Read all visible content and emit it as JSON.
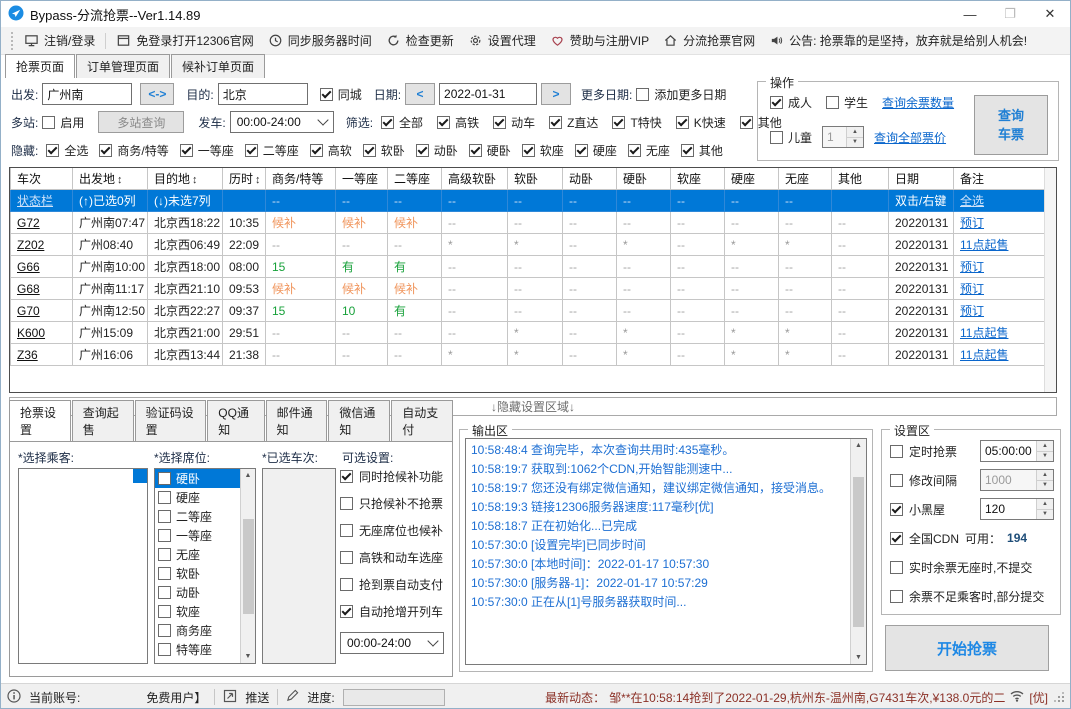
{
  "window": {
    "title": "Bypass-分流抢票--Ver1.14.89",
    "minimize": "—",
    "maximize": "❐",
    "close": "✕"
  },
  "toolbar": {
    "items": [
      {
        "label": "注销/登录",
        "icon": "monitor-icon",
        "sep_after": true
      },
      {
        "label": "免登录打开12306官网",
        "icon": "window-icon"
      },
      {
        "label": "同步服务器时间",
        "icon": "clock-icon"
      },
      {
        "label": "检查更新",
        "icon": "refresh-icon"
      },
      {
        "label": "设置代理",
        "icon": "gear-icon"
      },
      {
        "label": "赞助与注册VIP",
        "icon": "heart-icon"
      },
      {
        "label": "分流抢票官网",
        "icon": "home-icon"
      },
      {
        "label": "公告:  抢票靠的是坚持，放弃就是给别人机会!",
        "icon": "speaker-icon"
      }
    ]
  },
  "page_tabs": {
    "items": [
      {
        "label": "抢票页面"
      },
      {
        "label": "订单管理页面"
      },
      {
        "label": "候补订单页面"
      }
    ],
    "active": 0
  },
  "search": {
    "depart_label": "出发:",
    "depart_value": "广州南",
    "swap_label": "<->",
    "dest_label": "目的:",
    "dest_value": "北京",
    "same_city": {
      "label": "同城",
      "checked": true
    },
    "date_label": "日期:",
    "prev_label": "<",
    "date_value": "2022-01-31",
    "next_label": ">",
    "more_label": "更多日期:",
    "add_more": {
      "label": "添加更多日期",
      "checked": false
    }
  },
  "multi": {
    "label": "多站:",
    "enable": {
      "label": "启用",
      "checked": false
    },
    "query_btn": "多站查询",
    "depart_time_label": "发车:",
    "depart_time": "00:00-24:00",
    "filter_label": "筛选:",
    "filters": [
      {
        "label": "全部",
        "checked": true
      },
      {
        "label": "高铁",
        "checked": true
      },
      {
        "label": "动车",
        "checked": true
      },
      {
        "label": "Z直达",
        "checked": true
      },
      {
        "label": "T特快",
        "checked": true
      },
      {
        "label": "K快速",
        "checked": true
      },
      {
        "label": "其他",
        "checked": true
      }
    ]
  },
  "hide": {
    "label": "隐藏:",
    "items": [
      {
        "label": "全选",
        "checked": true
      },
      {
        "label": "商务/特等",
        "checked": true
      },
      {
        "label": "一等座",
        "checked": true
      },
      {
        "label": "二等座",
        "checked": true
      },
      {
        "label": "高软",
        "checked": true
      },
      {
        "label": "软卧",
        "checked": true
      },
      {
        "label": "动卧",
        "checked": true
      },
      {
        "label": "硬卧",
        "checked": true
      },
      {
        "label": "软座",
        "checked": true
      },
      {
        "label": "硬座",
        "checked": true
      },
      {
        "label": "无座",
        "checked": true
      },
      {
        "label": "其他",
        "checked": true
      }
    ]
  },
  "operation": {
    "title": "操作",
    "adult": {
      "label": "成人",
      "checked": true
    },
    "student": {
      "label": "学生",
      "checked": false
    },
    "child": {
      "label": "儿童",
      "checked": false
    },
    "child_count": "1",
    "link_seats": "查询余票数量",
    "link_price": "查询全部票价",
    "query_button_line1": "查询",
    "query_button_line2": "车票"
  },
  "table": {
    "columns": [
      {
        "label": "车次"
      },
      {
        "label": "出发地",
        "sort": "↕"
      },
      {
        "label": "目的地",
        "sort": "↕"
      },
      {
        "label": "历时",
        "sort": "↕"
      },
      {
        "label": "商务/特等"
      },
      {
        "label": "一等座"
      },
      {
        "label": "二等座"
      },
      {
        "label": "高级软卧"
      },
      {
        "label": "软卧"
      },
      {
        "label": "动卧"
      },
      {
        "label": "硬卧"
      },
      {
        "label": "软座"
      },
      {
        "label": "硬座"
      },
      {
        "label": "无座"
      },
      {
        "label": "其他"
      },
      {
        "label": "日期"
      },
      {
        "label": "备注"
      }
    ],
    "rows": [
      {
        "selected": true,
        "cells": [
          {
            "t": "状态栏",
            "s": "wlink"
          },
          {
            "t": "(↑)已选0列"
          },
          {
            "t": "(↓)未选7列"
          },
          {
            "t": ""
          },
          {
            "t": "--",
            "s": "dash"
          },
          {
            "t": "--",
            "s": "dash"
          },
          {
            "t": "--",
            "s": "dash"
          },
          {
            "t": "--",
            "s": "dash"
          },
          {
            "t": "--",
            "s": "dash"
          },
          {
            "t": "--",
            "s": "dash"
          },
          {
            "t": "--",
            "s": "dash"
          },
          {
            "t": "--",
            "s": "dash"
          },
          {
            "t": "--",
            "s": "dash"
          },
          {
            "t": "--",
            "s": "dash"
          },
          {
            "t": ""
          },
          {
            "t": "双击/右键"
          },
          {
            "t": "全选",
            "s": "wlink"
          }
        ]
      },
      {
        "cells": [
          {
            "t": "G72",
            "s": "train"
          },
          {
            "t": "广州南07:47"
          },
          {
            "t": "北京西18:22"
          },
          {
            "t": "10:35"
          },
          {
            "t": "候补",
            "s": "orange"
          },
          {
            "t": "候补",
            "s": "orange"
          },
          {
            "t": "候补",
            "s": "orange"
          },
          {
            "t": "--",
            "s": "dash"
          },
          {
            "t": "--",
            "s": "dash"
          },
          {
            "t": "--",
            "s": "dash"
          },
          {
            "t": "--",
            "s": "dash"
          },
          {
            "t": "--",
            "s": "dash"
          },
          {
            "t": "--",
            "s": "dash"
          },
          {
            "t": "--",
            "s": "dash"
          },
          {
            "t": "--",
            "s": "dash"
          },
          {
            "t": "20220131"
          },
          {
            "t": "预订",
            "s": "link"
          }
        ]
      },
      {
        "cells": [
          {
            "t": "Z202",
            "s": "train"
          },
          {
            "t": "广州08:40"
          },
          {
            "t": "北京西06:49"
          },
          {
            "t": "22:09"
          },
          {
            "t": "--",
            "s": "dash"
          },
          {
            "t": "--",
            "s": "dash"
          },
          {
            "t": "--",
            "s": "dash"
          },
          {
            "t": "*",
            "s": "star"
          },
          {
            "t": "*",
            "s": "star"
          },
          {
            "t": "--",
            "s": "dash"
          },
          {
            "t": "*",
            "s": "star"
          },
          {
            "t": "--",
            "s": "dash"
          },
          {
            "t": "*",
            "s": "star"
          },
          {
            "t": "*",
            "s": "star"
          },
          {
            "t": "--",
            "s": "dash"
          },
          {
            "t": "20220131"
          },
          {
            "t": "11点起售",
            "s": "link"
          }
        ]
      },
      {
        "cells": [
          {
            "t": "G66",
            "s": "train"
          },
          {
            "t": "广州南10:00"
          },
          {
            "t": "北京西18:00"
          },
          {
            "t": "08:00"
          },
          {
            "t": "15",
            "s": "green"
          },
          {
            "t": "有",
            "s": "green"
          },
          {
            "t": "有",
            "s": "green"
          },
          {
            "t": "--",
            "s": "dash"
          },
          {
            "t": "--",
            "s": "dash"
          },
          {
            "t": "--",
            "s": "dash"
          },
          {
            "t": "--",
            "s": "dash"
          },
          {
            "t": "--",
            "s": "dash"
          },
          {
            "t": "--",
            "s": "dash"
          },
          {
            "t": "--",
            "s": "dash"
          },
          {
            "t": "--",
            "s": "dash"
          },
          {
            "t": "20220131"
          },
          {
            "t": "预订",
            "s": "link"
          }
        ]
      },
      {
        "cells": [
          {
            "t": "G68",
            "s": "train"
          },
          {
            "t": "广州南11:17"
          },
          {
            "t": "北京西21:10"
          },
          {
            "t": "09:53"
          },
          {
            "t": "候补",
            "s": "orange"
          },
          {
            "t": "候补",
            "s": "orange"
          },
          {
            "t": "候补",
            "s": "orange"
          },
          {
            "t": "--",
            "s": "dash"
          },
          {
            "t": "--",
            "s": "dash"
          },
          {
            "t": "--",
            "s": "dash"
          },
          {
            "t": "--",
            "s": "dash"
          },
          {
            "t": "--",
            "s": "dash"
          },
          {
            "t": "--",
            "s": "dash"
          },
          {
            "t": "--",
            "s": "dash"
          },
          {
            "t": "--",
            "s": "dash"
          },
          {
            "t": "20220131"
          },
          {
            "t": "预订",
            "s": "link"
          }
        ]
      },
      {
        "cells": [
          {
            "t": "G70",
            "s": "train"
          },
          {
            "t": "广州南12:50"
          },
          {
            "t": "北京西22:27"
          },
          {
            "t": "09:37"
          },
          {
            "t": "15",
            "s": "green"
          },
          {
            "t": "10",
            "s": "green"
          },
          {
            "t": "有",
            "s": "green"
          },
          {
            "t": "--",
            "s": "dash"
          },
          {
            "t": "--",
            "s": "dash"
          },
          {
            "t": "--",
            "s": "dash"
          },
          {
            "t": "--",
            "s": "dash"
          },
          {
            "t": "--",
            "s": "dash"
          },
          {
            "t": "--",
            "s": "dash"
          },
          {
            "t": "--",
            "s": "dash"
          },
          {
            "t": "--",
            "s": "dash"
          },
          {
            "t": "20220131"
          },
          {
            "t": "预订",
            "s": "link"
          }
        ]
      },
      {
        "cells": [
          {
            "t": "K600",
            "s": "train"
          },
          {
            "t": "广州15:09"
          },
          {
            "t": "北京西21:00"
          },
          {
            "t": "29:51"
          },
          {
            "t": "--",
            "s": "dash"
          },
          {
            "t": "--",
            "s": "dash"
          },
          {
            "t": "--",
            "s": "dash"
          },
          {
            "t": "--",
            "s": "dash"
          },
          {
            "t": "*",
            "s": "star"
          },
          {
            "t": "--",
            "s": "dash"
          },
          {
            "t": "*",
            "s": "star"
          },
          {
            "t": "--",
            "s": "dash"
          },
          {
            "t": "*",
            "s": "star"
          },
          {
            "t": "*",
            "s": "star"
          },
          {
            "t": "--",
            "s": "dash"
          },
          {
            "t": "20220131"
          },
          {
            "t": "11点起售",
            "s": "link"
          }
        ]
      },
      {
        "cells": [
          {
            "t": "Z36",
            "s": "train"
          },
          {
            "t": "广州16:06"
          },
          {
            "t": "北京西13:44"
          },
          {
            "t": "21:38"
          },
          {
            "t": "--",
            "s": "dash"
          },
          {
            "t": "--",
            "s": "dash"
          },
          {
            "t": "--",
            "s": "dash"
          },
          {
            "t": "*",
            "s": "star"
          },
          {
            "t": "*",
            "s": "star"
          },
          {
            "t": "--",
            "s": "dash"
          },
          {
            "t": "*",
            "s": "star"
          },
          {
            "t": "--",
            "s": "dash"
          },
          {
            "t": "*",
            "s": "star"
          },
          {
            "t": "*",
            "s": "star"
          },
          {
            "t": "--",
            "s": "dash"
          },
          {
            "t": "20220131"
          },
          {
            "t": "11点起售",
            "s": "link"
          }
        ]
      }
    ]
  },
  "divider_label": "↓隐藏设置区域↓",
  "settings_tabs": {
    "items": [
      {
        "label": "抢票设置"
      },
      {
        "label": "查询起售"
      },
      {
        "label": "验证码设置"
      },
      {
        "label": "QQ通知"
      },
      {
        "label": "邮件通知"
      },
      {
        "label": "微信通知"
      },
      {
        "label": "自动支付"
      }
    ],
    "active": 0
  },
  "grab": {
    "passengers_label": "*选择乘客:",
    "seats_label": "*选择席位:",
    "trains_label": "*已选车次:",
    "options_label": "可选设置:",
    "seats": [
      {
        "label": "硬卧",
        "checked": false,
        "selected": true
      },
      {
        "label": "硬座",
        "checked": false
      },
      {
        "label": "二等座",
        "checked": false
      },
      {
        "label": "一等座",
        "checked": false
      },
      {
        "label": "无座",
        "checked": false
      },
      {
        "label": "软卧",
        "checked": false
      },
      {
        "label": "动卧",
        "checked": false
      },
      {
        "label": "软座",
        "checked": false
      },
      {
        "label": "商务座",
        "checked": false
      },
      {
        "label": "特等座",
        "checked": false
      }
    ],
    "options": [
      {
        "label": "同时抢候补功能",
        "checked": true
      },
      {
        "label": "只抢候补不抢票",
        "checked": false
      },
      {
        "label": "无座席位也候补",
        "checked": false
      },
      {
        "label": "高铁和动车选座",
        "checked": false
      },
      {
        "label": "抢到票自动支付",
        "checked": false
      },
      {
        "label": "自动抢增开列车",
        "checked": true
      }
    ],
    "time_range": "00:00-24:00"
  },
  "output": {
    "title": "输出区",
    "lines": [
      "10:58:48:4  查询完毕，本次查询共用时:435毫秒。",
      "10:58:19:7  获取到:1062个CDN,开始智能测速中...",
      "10:58:19:7  您还没有绑定微信通知，建议绑定微信通知，接受消息。",
      "10:58:19:3  链接12306服务器速度:117毫秒[优]",
      "10:58:18:7  正在初始化...已完成",
      "10:57:30:0  [设置完毕]已同步时间",
      "10:57:30:0  [本地时间]：2022-01-17 10:57:30",
      "10:57:30:0  [服务器-1]：2022-01-17 10:57:29",
      "10:57:30:0  正在从[1]号服务器获取时间..."
    ]
  },
  "settings_area": {
    "title": "设置区",
    "rows": [
      {
        "label": "定时抢票",
        "checked": false,
        "value": "05:00:00",
        "spinner": true
      },
      {
        "label": "修改间隔",
        "checked": false,
        "value": "1000",
        "spinner": true,
        "disabled": true
      },
      {
        "label": "小黑屋",
        "checked": true,
        "value": "120",
        "spinner": true
      },
      {
        "label": "全国CDN",
        "checked": true,
        "suffix_label": "可用：",
        "suffix_value": "194"
      },
      {
        "label": "实时余票无座时,不提交",
        "checked": false
      },
      {
        "label": "余票不足乘客时,部分提交",
        "checked": false
      }
    ],
    "start_button": "开始抢票"
  },
  "statusbar": {
    "account_label": "当前账号:",
    "account_value": "免费用户】",
    "push_label": "推送",
    "progress_label": "进度:",
    "latest_label": "最新动态：",
    "latest_text": "邹**在10:58:14抢到了2022-01-29,杭州东-温州南,G7431车次,¥138.0元的二",
    "signal_quality": "[优]"
  }
}
